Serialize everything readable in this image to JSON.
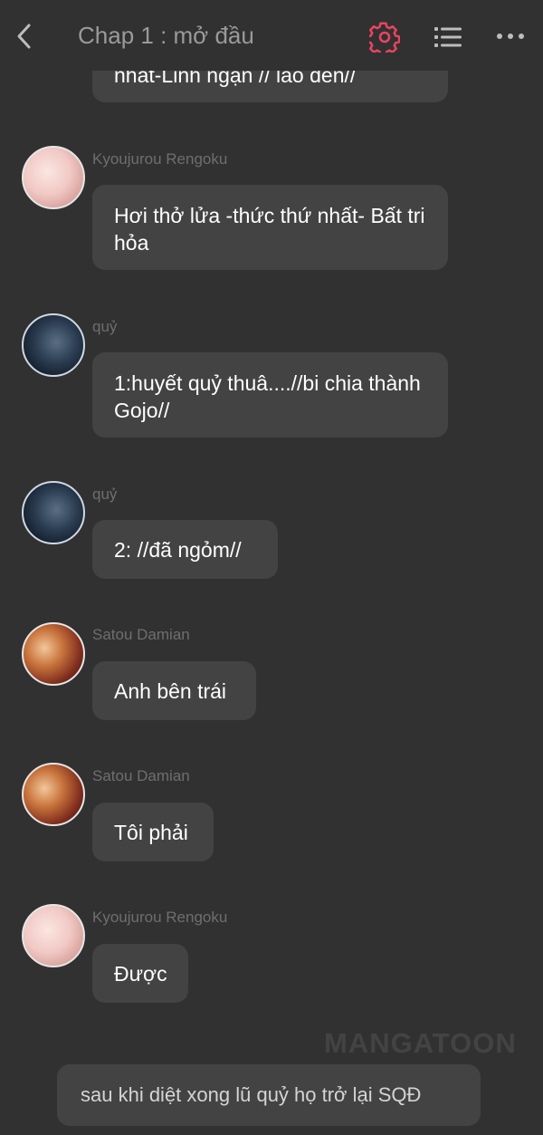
{
  "header": {
    "title": "Chap 1 : mở đầu",
    "back_icon": "chevron-left-icon",
    "settings_icon": "gear-icon",
    "menu_icon": "list-icon",
    "more_icon": "more-horizontal-icon",
    "accent_color": "#e8445f"
  },
  "messages": [
    {
      "sender": "",
      "text": "nhất-Linh ngạn // lao đến//"
    },
    {
      "sender": "Kyoujurou Rengoku",
      "text": "Hơi thở lửa -thức thứ nhất- Bất tri hỏa"
    },
    {
      "sender": "quỷ",
      "text": "1:huyết quỷ thuâ....//bi chia thành Gojo//"
    },
    {
      "sender": "quỷ",
      "text": "2: //đã ngỏm//"
    },
    {
      "sender": "Satou Damian",
      "text": "Anh bên trái"
    },
    {
      "sender": "Satou Damian",
      "text": "Tôi phải"
    },
    {
      "sender": "Kyoujurou Rengoku",
      "text": "Được"
    }
  ],
  "narration": {
    "text": "sau khi diệt xong lũ quỷ họ trở lại SQĐ"
  },
  "watermark": {
    "text": "MANGATOON"
  }
}
